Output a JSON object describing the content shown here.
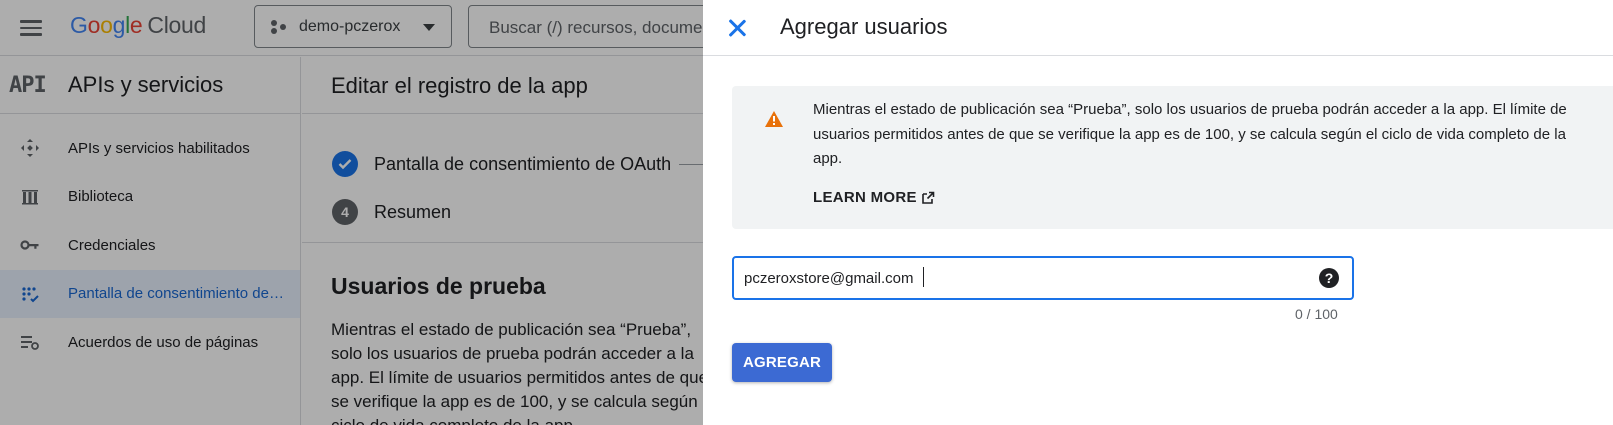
{
  "topbar": {
    "logo_text": "Google Cloud",
    "project": "demo-pczerox",
    "search_placeholder": "Buscar (/) recursos, documentos, productos y más"
  },
  "sidebar": {
    "api_mark": "API",
    "title": "APIs y servicios",
    "items": [
      {
        "label": "APIs y servicios habilitados",
        "icon": "apis-icon"
      },
      {
        "label": "Biblioteca",
        "icon": "library-icon"
      },
      {
        "label": "Credenciales",
        "icon": "key-icon"
      },
      {
        "label": "Pantalla de consentimiento de OAuth",
        "icon": "consent-icon",
        "active": true
      },
      {
        "label": "Acuerdos de uso de páginas",
        "icon": "settings-list-icon"
      }
    ]
  },
  "main": {
    "title": "Editar el registro de la app",
    "steps": [
      {
        "label": "Pantalla de consentimiento de OAuth",
        "state": "done"
      },
      {
        "label": "Resumen",
        "number": "4"
      }
    ],
    "section_title": "Usuarios de prueba",
    "section_body": "Mientras el estado de publicación sea “Prueba”, solo los usuarios de prueba podrán acceder a la app. El límite de usuarios permitidos antes de que se verifique la app es de 100, y se calcula según el ciclo de vida completo de la app."
  },
  "panel": {
    "title": "Agregar usuarios",
    "alert_text": "Mientras el estado de publicación sea “Prueba”, solo los usuarios de prueba podrán acceder a la app. El límite de usuarios permitidos antes de que se verifique la app es de 100, y se calcula según el ciclo de vida completo de la app.",
    "learn_more": "LEARN MORE",
    "email_value": "pczeroxstore@gmail.com",
    "counter": "0 / 100",
    "add_button": "AGREGAR"
  },
  "colors": {
    "accent": "#1a73e8",
    "button": "#3c6ad3",
    "warning": "#e8710a",
    "alert_bg": "#f1f3f4"
  }
}
